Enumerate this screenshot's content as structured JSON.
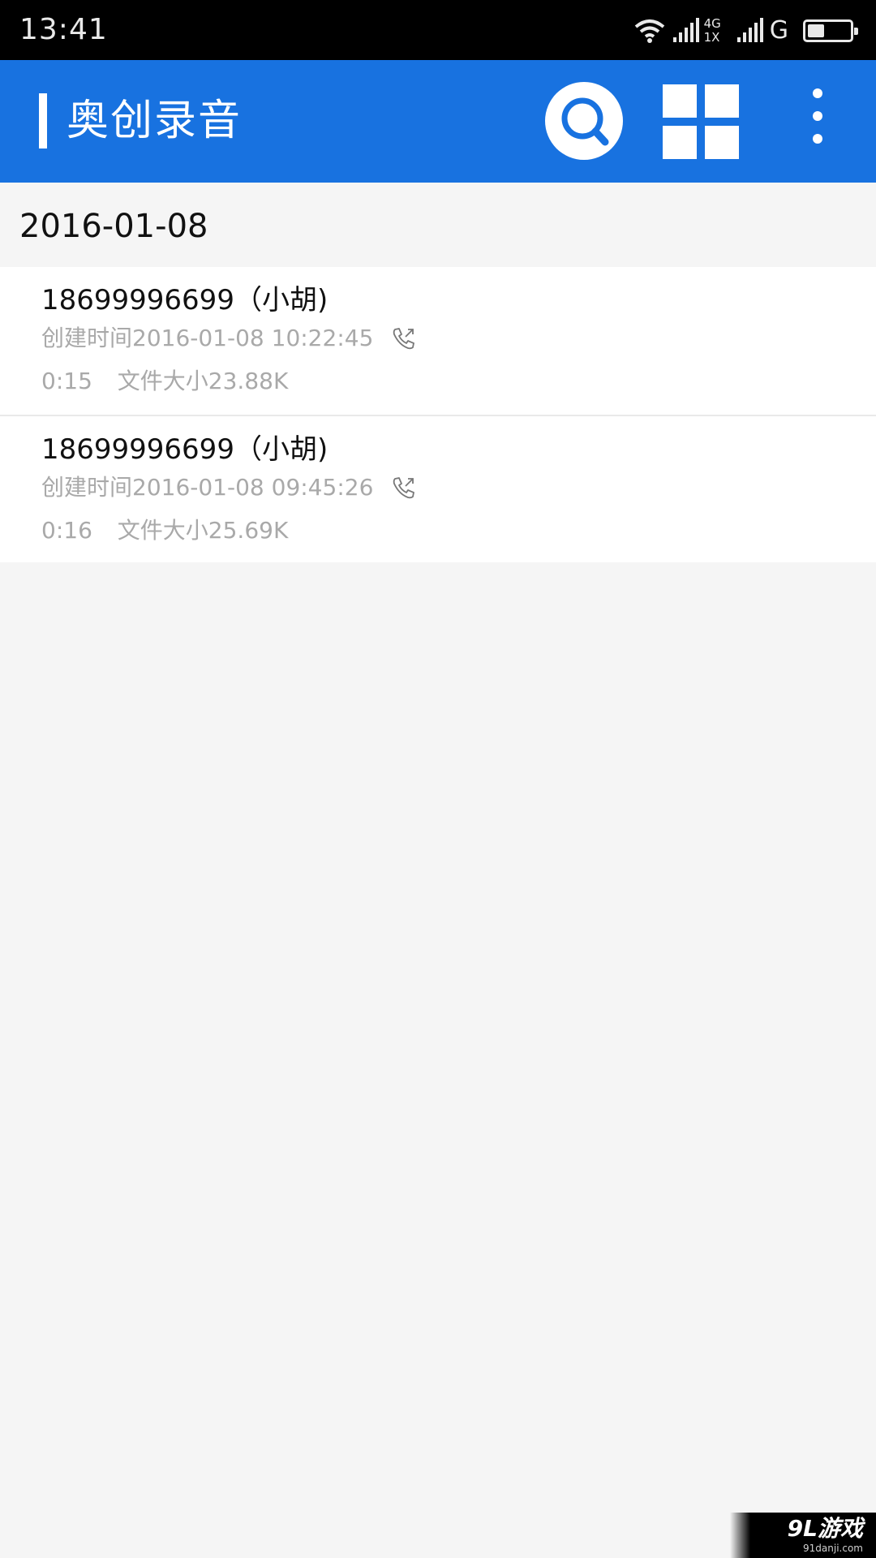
{
  "status_bar": {
    "time": "13:41",
    "network_label_top": "4G",
    "network_label_bottom": "1X",
    "second_network_label": "G",
    "battery_level_percent": 40,
    "icons": [
      "wifi-icon",
      "signal-icon",
      "signal-icon",
      "battery-icon"
    ]
  },
  "app_bar": {
    "title": "奥创录音",
    "color": "#1872e0",
    "actions": [
      "search-icon",
      "grid-icon",
      "more-vertical-icon"
    ]
  },
  "list": {
    "date": "2016-01-08",
    "records": [
      {
        "name": "18699996699（小胡)",
        "created": "创建时间2016-01-08 10:22:45",
        "duration": "0:15",
        "file_size": "文件大小23.88K",
        "icon": "outgoing-call-icon"
      },
      {
        "name": "18699996699（小胡)",
        "created": "创建时间2016-01-08 09:45:26",
        "duration": "0:16",
        "file_size": "文件大小25.69K",
        "icon": "outgoing-call-icon"
      }
    ]
  },
  "watermark": {
    "logo": "9L游戏",
    "site": "91danji.com"
  }
}
